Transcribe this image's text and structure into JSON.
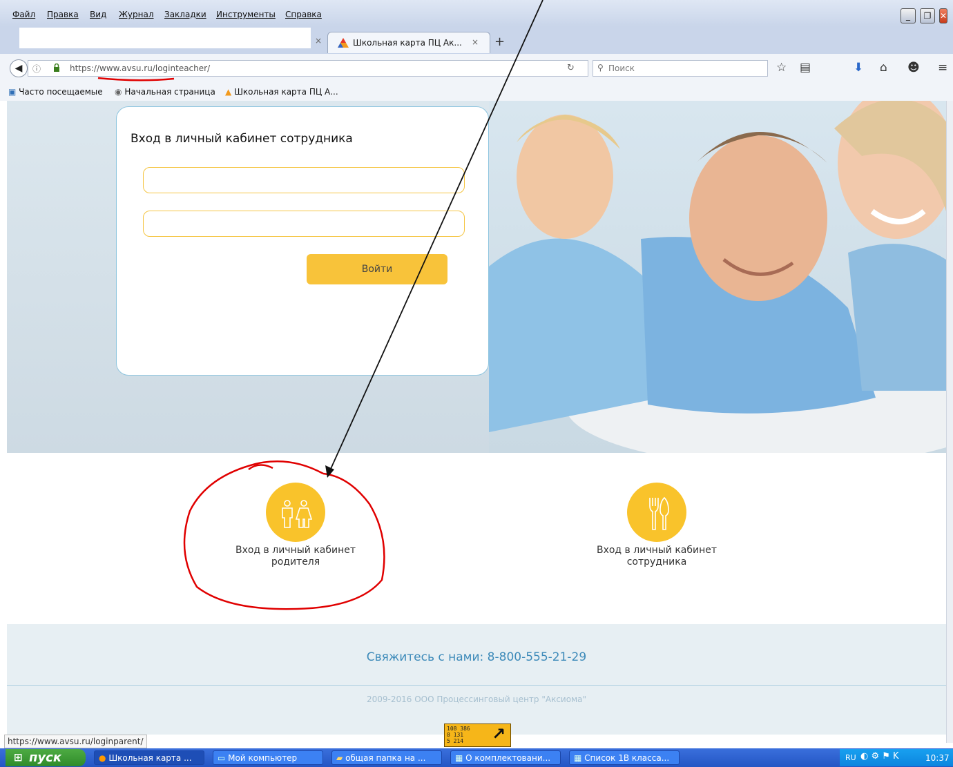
{
  "menu": [
    "Файл",
    "Правка",
    "Вид",
    "Журнал",
    "Закладки",
    "Инструменты",
    "Справка"
  ],
  "tabs": {
    "close_glyph": "×",
    "active_title": "Школьная карта ПЦ Ак...",
    "new_tab_glyph": "+"
  },
  "nav": {
    "url": "https://www.avsu.ru/loginteacher/",
    "search_placeholder": "Поиск"
  },
  "bookmarks": [
    "Часто посещаемые",
    "Начальная страница",
    "Школьная карта ПЦ А..."
  ],
  "login": {
    "title": "Вход в личный кабинет сотрудника",
    "button": "Войти"
  },
  "links": {
    "parent_line1": "Вход в личный кабинет",
    "parent_line2": "родителя",
    "staff_line1": "Вход в личный кабинет",
    "staff_line2": "сотрудника"
  },
  "footer": {
    "contact": "Свяжитесь с нами: 8-800-555-21-29",
    "copyright": "2009-2016 ООО Процессинговый центр \"Аксиома\""
  },
  "status_url": "https://www.avsu.ru/loginparent/",
  "badge": {
    "line1": "108 386",
    "line2": "8 131",
    "line3": "5 214"
  },
  "taskbar": {
    "start": "пуск",
    "items": [
      "Школьная карта ...",
      "Мой компьютер",
      "общая папка на ...",
      "О комплектовани...",
      "Список 1В класса..."
    ],
    "lang": "RU",
    "time": "10:37"
  },
  "icons": {
    "back": "back-arrow-icon",
    "info": "info-icon",
    "lock": "lock-icon",
    "reload": "reload-icon",
    "search": "search-icon",
    "bookmark_star": "star-icon",
    "library": "library-icon",
    "download": "download-icon",
    "home": "home-icon",
    "chat": "pocket-icon",
    "menu": "hamburger-icon",
    "parents": "parents-icon",
    "cutlery": "cutlery-icon"
  },
  "colors": {
    "accent": "#f9c32b",
    "contact_text": "#3d8ab9",
    "taskbar": "#2456c4",
    "annotation": "#e00000"
  }
}
